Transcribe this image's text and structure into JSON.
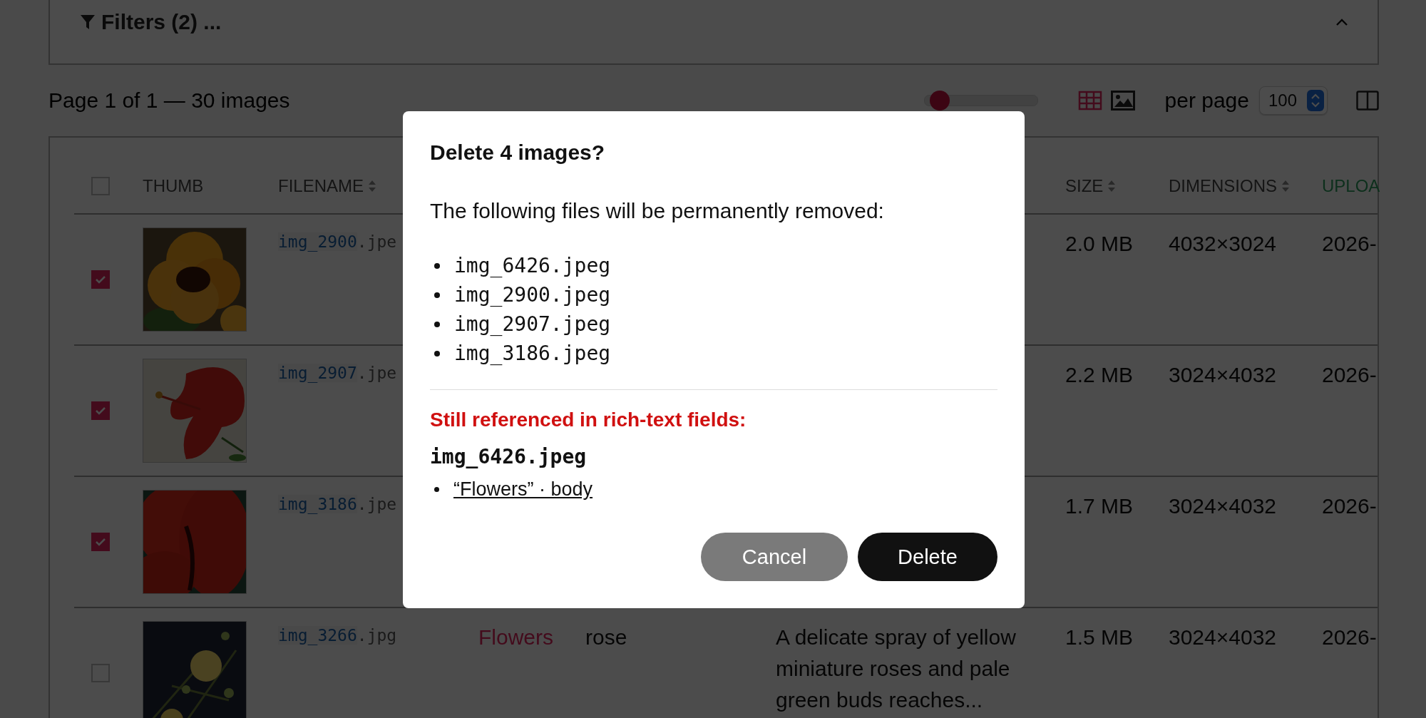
{
  "filters": {
    "label": "Filters (2) ...",
    "expanded": true
  },
  "toolbar": {
    "summary": "Page 1 of 1 — 30 images",
    "thumb_size": {
      "level": 0.05
    },
    "view_modes": [
      {
        "kind": "table",
        "selected": true
      },
      {
        "kind": "gallery",
        "selected": false
      }
    ],
    "per_page_label": "per page",
    "per_page": "100"
  },
  "table": {
    "header": {
      "select_all": {
        "checked": false
      },
      "thumb": {
        "label": "THUMB",
        "sortable": false,
        "sorted": false
      },
      "filename": {
        "label": "FILENAME",
        "sortable": true,
        "sorted": false
      },
      "size": {
        "label": "SIZE",
        "sortable": true,
        "sorted": false
      },
      "dimensions": {
        "label": "DIMENSIONS",
        "sortable": true,
        "sorted": false
      },
      "uploaded": {
        "label": "UPLOA",
        "sortable": false,
        "sorted": true
      }
    },
    "rows": [
      {
        "checked": true,
        "filename": {
          "name": "img_2900",
          "ext": ".jpe"
        },
        "size": "2.0 MB",
        "dimensions": "4032×3024",
        "uploaded": "2026-"
      },
      {
        "checked": true,
        "filename": {
          "name": "img_2907",
          "ext": ".jpe"
        },
        "size": "2.2 MB",
        "dimensions": "3024×4032",
        "uploaded": "2026-"
      },
      {
        "checked": true,
        "filename": {
          "name": "img_3186",
          "ext": ".jpe"
        },
        "size": "1.7 MB",
        "dimensions": "3024×4032",
        "uploaded": "2026-"
      },
      {
        "checked": false,
        "filename": {
          "name": "img_3266",
          "ext": ".jpg"
        },
        "category": "Flowers",
        "tags": "rose",
        "description": "A delicate spray of yellow miniature roses and pale green buds reaches...",
        "size": "1.5 MB",
        "dimensions": "3024×4032",
        "uploaded": "2026-"
      }
    ]
  },
  "dialog": {
    "title": "Delete 4 images?",
    "message": "The following files will be permanently removed:",
    "files": [
      "img_6426.jpeg",
      "img_2900.jpeg",
      "img_2907.jpeg",
      "img_3186.jpeg"
    ],
    "warning": "Still referenced in rich-text fields:",
    "references": [
      {
        "file": "img_6426.jpeg",
        "links": [
          "“Flowers” · body"
        ]
      }
    ],
    "buttons": [
      {
        "label": "Cancel",
        "kind": "secondary"
      },
      {
        "label": "Delete",
        "kind": "danger"
      }
    ]
  }
}
